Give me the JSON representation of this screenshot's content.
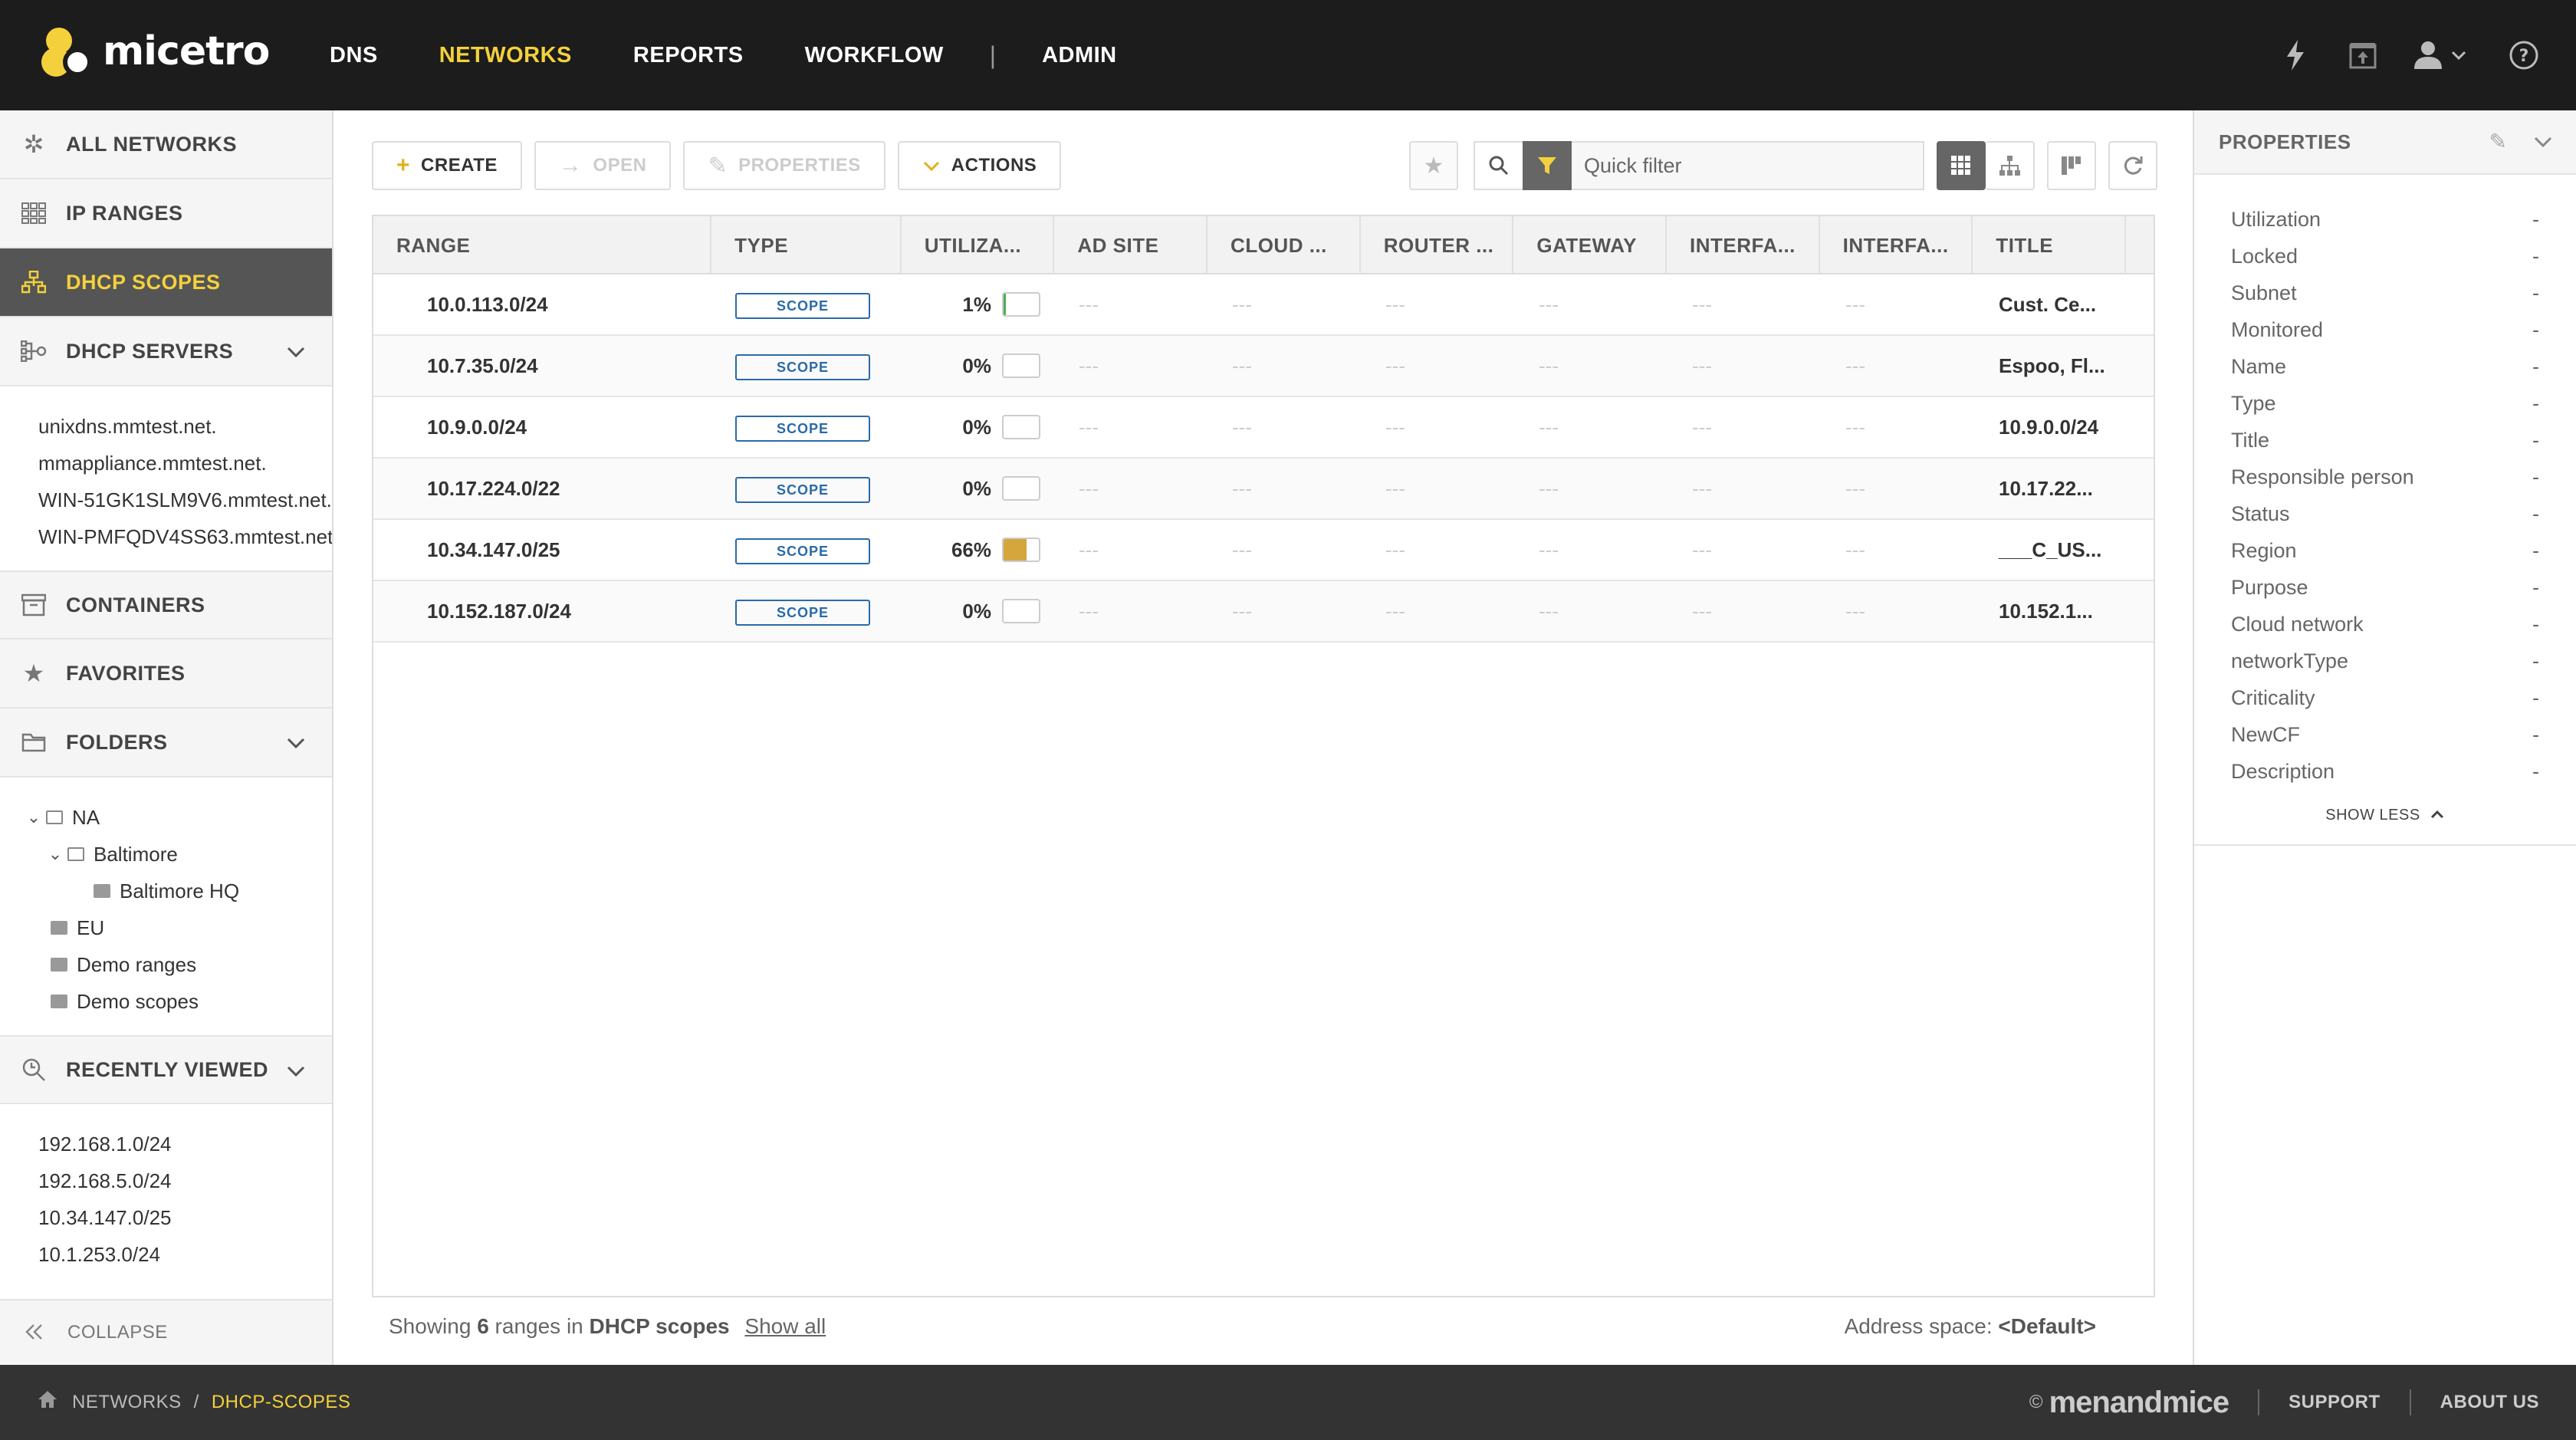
{
  "app": {
    "brand": "micetro"
  },
  "nav": {
    "items": [
      {
        "label": "DNS",
        "active": false
      },
      {
        "label": "NETWORKS",
        "active": true
      },
      {
        "label": "REPORTS",
        "active": false
      },
      {
        "label": "WORKFLOW",
        "active": false
      },
      {
        "label": "ADMIN",
        "active": false
      }
    ],
    "separator": "|"
  },
  "sidebar": {
    "all_networks": "ALL NETWORKS",
    "ip_ranges": "IP RANGES",
    "dhcp_scopes": "DHCP SCOPES",
    "dhcp_servers": "DHCP SERVERS",
    "servers": [
      "unixdns.mmtest.net.",
      "mmappliance.mmtest.net.",
      "WIN-51GK1SLM9V6.mmtest.net.",
      "WIN-PMFQDV4SS63.mmtest.net."
    ],
    "containers": "CONTAINERS",
    "favorites": "FAVORITES",
    "folders": "FOLDERS",
    "tree": {
      "na": "NA",
      "baltimore": "Baltimore",
      "baltimore_hq": "Baltimore HQ",
      "eu": "EU",
      "demo_ranges": "Demo ranges",
      "demo_scopes": "Demo scopes"
    },
    "recently_viewed": "RECENTLY VIEWED",
    "recent": [
      "192.168.1.0/24",
      "192.168.5.0/24",
      "10.34.147.0/25",
      "10.1.253.0/24"
    ],
    "collapse": "COLLAPSE"
  },
  "toolbar": {
    "create": "CREATE",
    "open": "OPEN",
    "properties": "PROPERTIES",
    "actions": "ACTIONS",
    "quick_filter_placeholder": "Quick filter"
  },
  "grid": {
    "columns": [
      "RANGE",
      "TYPE",
      "UTILIZA...",
      "AD SITE",
      "CLOUD ...",
      "ROUTER ...",
      "GATEWAY",
      "INTERFA...",
      "INTERFA...",
      "TITLE"
    ],
    "empty_value": "---",
    "scope_label": "SCOPE",
    "rows": [
      {
        "range": "10.0.113.0/24",
        "util": "1%",
        "util_value": 0.01,
        "title": "Cust. Ce..."
      },
      {
        "range": "10.7.35.0/24",
        "util": "0%",
        "util_value": 0,
        "title": "Espoo, Fl..."
      },
      {
        "range": "10.9.0.0/24",
        "util": "0%",
        "util_value": 0,
        "title": "10.9.0.0/24"
      },
      {
        "range": "10.17.224.0/22",
        "util": "0%",
        "util_value": 0,
        "title": "10.17.22..."
      },
      {
        "range": "10.34.147.0/25",
        "util": "66%",
        "util_value": 0.66,
        "title": "___C_US..."
      },
      {
        "range": "10.152.187.0/24",
        "util": "0%",
        "util_value": 0,
        "title": "10.152.1..."
      }
    ]
  },
  "status": {
    "showing": "Showing",
    "count": "6",
    "ranges_in": "ranges in",
    "location": "DHCP scopes",
    "show_all": "Show all",
    "address_space_label": "Address space:",
    "address_space_value": "<Default>"
  },
  "properties": {
    "title": "PROPERTIES",
    "items": [
      {
        "label": "Utilization",
        "value": "-"
      },
      {
        "label": "Locked",
        "value": "-"
      },
      {
        "label": "Subnet",
        "value": "-"
      },
      {
        "label": "Monitored",
        "value": "-"
      },
      {
        "label": "Name",
        "value": "-"
      },
      {
        "label": "Type",
        "value": "-"
      },
      {
        "label": "Title",
        "value": "-"
      },
      {
        "label": "Responsible person",
        "value": "-"
      },
      {
        "label": "Status",
        "value": "-"
      },
      {
        "label": "Region",
        "value": "-"
      },
      {
        "label": "Purpose",
        "value": "-"
      },
      {
        "label": "Cloud network",
        "value": "-"
      },
      {
        "label": "networkType",
        "value": "-"
      },
      {
        "label": "Criticality",
        "value": "-"
      },
      {
        "label": "NewCF",
        "value": "-"
      },
      {
        "label": "Description",
        "value": "-"
      }
    ],
    "show_less": "SHOW LESS"
  },
  "footer": {
    "crumb_networks": "NETWORKS",
    "crumb_sep": "/",
    "crumb_current": "DHCP-SCOPES",
    "copyright": "©",
    "brand": "menandmice",
    "support": "SUPPORT",
    "about": "ABOUT US"
  },
  "colors": {
    "accent": "#f4d13c",
    "topbar": "#1c1c1c",
    "scope_badge": "#2a6aa6",
    "util_low": "#4caf50",
    "util_mid": "#d4a63c"
  }
}
